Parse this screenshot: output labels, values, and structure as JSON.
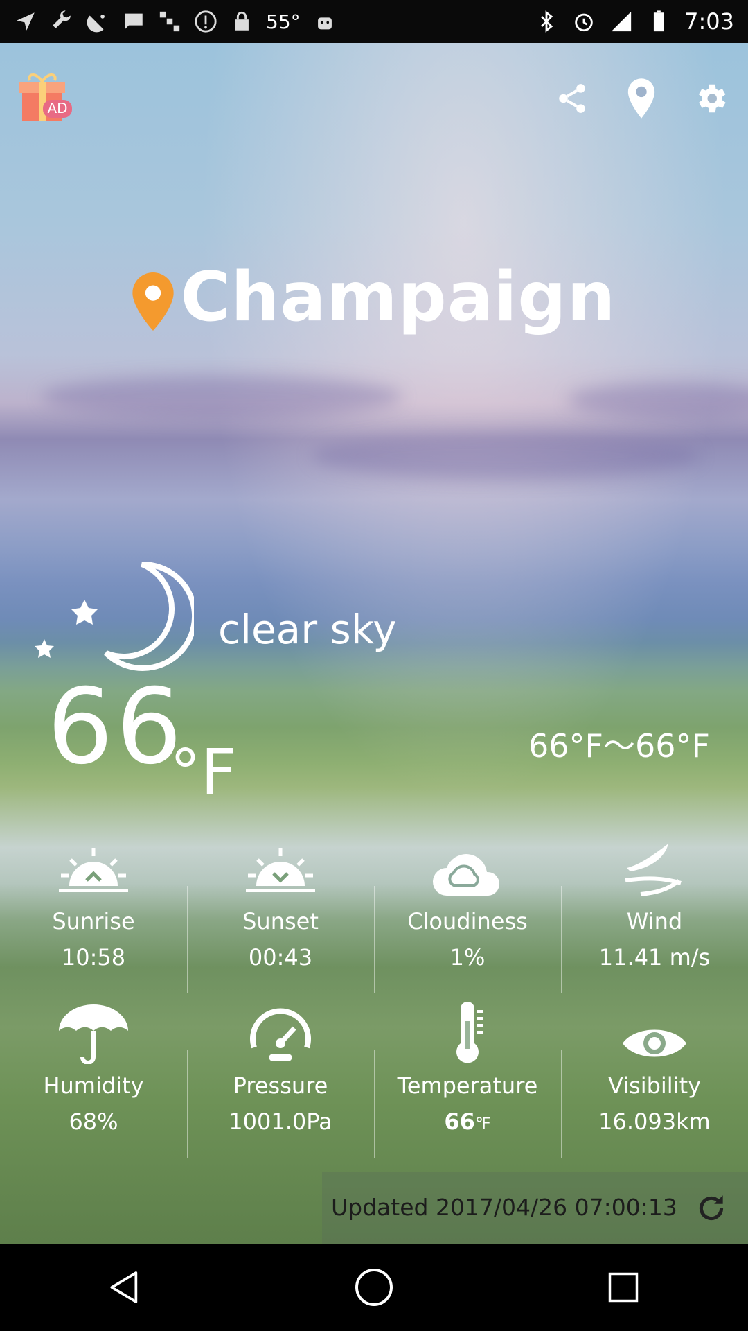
{
  "status_bar": {
    "temperature": "55°",
    "time": "7:03"
  },
  "header": {
    "ad_label": "AD"
  },
  "location": {
    "city": "Champaign"
  },
  "current": {
    "condition": "clear sky",
    "temperature": "66",
    "unit": "°F",
    "range": "66°F～66°F"
  },
  "stats_row1": [
    {
      "label": "Sunrise",
      "value": "10:58",
      "icon": "sunrise-icon"
    },
    {
      "label": "Sunset",
      "value": "00:43",
      "icon": "sunset-icon"
    },
    {
      "label": "Cloudiness",
      "value": "1%",
      "icon": "cloud-icon"
    },
    {
      "label": "Wind",
      "value": "11.41 m/s",
      "icon": "wind-icon"
    }
  ],
  "stats_row2": [
    {
      "label": "Humidity",
      "value": "68%",
      "icon": "umbrella-icon"
    },
    {
      "label": "Pressure",
      "value": "1001.0Pa",
      "icon": "gauge-icon"
    },
    {
      "label": "Temperature",
      "value": "66",
      "unit": "℉",
      "icon": "thermometer-icon"
    },
    {
      "label": "Visibility",
      "value": "16.093km",
      "icon": "eye-icon"
    }
  ],
  "footer": {
    "updated": "Updated 2017/04/26 07:00:13"
  },
  "colors": {
    "pin_orange": "#f49a2e",
    "text": "#ffffff"
  }
}
